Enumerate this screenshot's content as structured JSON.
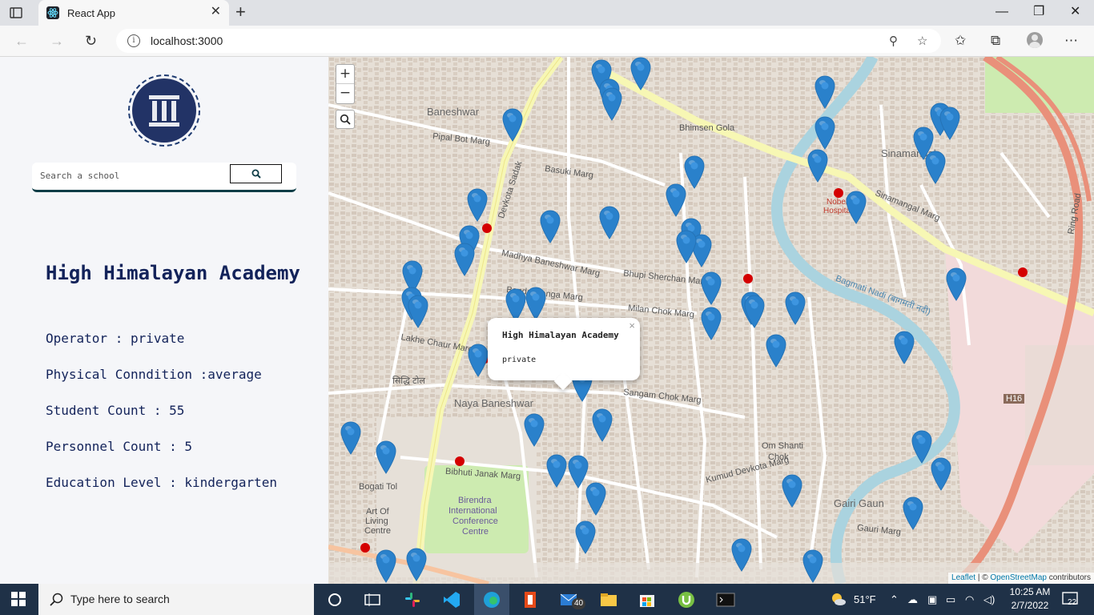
{
  "browser": {
    "tab_title": "React App",
    "url": "localhost:3000"
  },
  "sidebar": {
    "search_placeholder": "Search a school",
    "school_name": "High Himalayan Academy",
    "operator_label": "Operator : private",
    "physical_label": "Physical Conndition :average",
    "student_label": "Student Count : 55",
    "personnel_label": "Personnel Count : 5",
    "education_label": "Education Level : kindergarten"
  },
  "map": {
    "zoom_in": "+",
    "zoom_out": "−",
    "popup_title": "High Himalayan Academy",
    "popup_sub": "private",
    "popup_close": "×",
    "attrib_leaflet": "Leaflet",
    "attrib_sep": " | © ",
    "attrib_osm": "OpenStreetMap",
    "attrib_contrib": " contributors",
    "labels": {
      "baneshwar": "Baneshwar",
      "naya_baneshwar": "Naya Baneshwar",
      "sinamangal": "Sinamangal",
      "gairi_gaun": "Gairi Gaun",
      "om_shanti_chok": "Om Shanti",
      "om_shanti_chok2": "Chok",
      "bhimsen_gola": "Bhimsen Gola",
      "nobel_hospital": "Nobel",
      "nobel_hospital2": "Hospital",
      "birendra": "Birendra",
      "birendra2": "International",
      "birendra3": "Conference",
      "birendra4": "Centre",
      "bogati_tol": "Bogati Tol",
      "art_of_living": "Art Of",
      "art_of_living2": "Living",
      "art_of_living3": "Centre",
      "sinamangal_marg": "Sinamangal Marg",
      "basuki_marg": "Basuki Marg",
      "devkota_sadak": "Devkota Sadak",
      "ring_road": "Ring Road",
      "h16": "H16",
      "bagmati": "Bagmati Nadi (बागमती नदी)",
      "madhya_baneshwar": "Madhya Baneshwar Marg",
      "sangam_chok": "Sangam Chok Marg",
      "milan_chok": "Milan Chok Marg",
      "bhupi": "Bhupi Sherchan Marg",
      "banda_ganga": "Banda Ganga Marg",
      "bibhuti": "Bibhuti Janak Marg",
      "pipal_bot": "Pipal Bot Marg",
      "gauri_marg": "Gauri Marg",
      "kumud": "Kumud Devkota Marg",
      "lakhe_chaur": "Lakhe Chaur Marg",
      "siddhi_tol": "सिद्धि टोल"
    }
  },
  "taskbar": {
    "search_text": "Type here to search",
    "weather": "51°F",
    "time": "10:25 AM",
    "date": "2/7/2022",
    "mail_count": "40",
    "notif_count": "22"
  },
  "colors": {
    "marker": "#2a81cb",
    "sidebar_text": "#13235a",
    "taskbar": "#1f3147"
  }
}
